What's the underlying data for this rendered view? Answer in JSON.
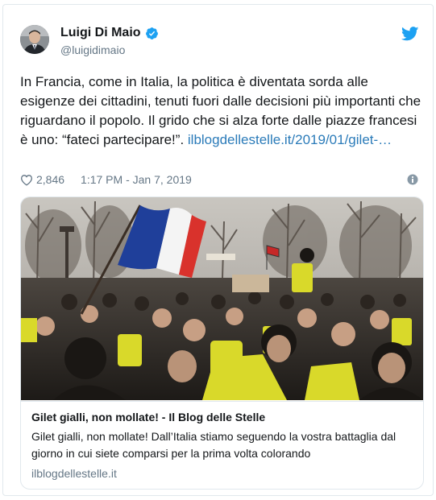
{
  "user": {
    "display_name": "Luigi Di Maio",
    "handle": "@luigidimaio",
    "verified_icon": "verified-badge-icon"
  },
  "tweet": {
    "text": "In Francia, come in Italia, la politica è diventata sorda alle esigenze dei cittadini, tenuti fuori dalle decisioni più importanti che riguardano il popolo. Il grido che si alza forte dalle piazze francesi è uno: “fateci partecipare!”. ",
    "link_text": "ilblogdellestelle.it/2019/01/gilet-…"
  },
  "meta": {
    "likes": "2,846",
    "timestamp": "1:17 PM - Jan 7, 2019"
  },
  "card": {
    "title": "Gilet gialli, non mollate! - Il Blog delle Stelle",
    "description": "Gilet gialli, non mollate! Dall’Italia stiamo seguendo la vostra battaglia dal giorno in cui siete comparsi per la prima volta colorando",
    "domain": "ilblogdellestelle.it"
  },
  "colors": {
    "link": "#2b7bb9",
    "twitter_blue": "#1da1f2",
    "muted": "#657786",
    "border": "#e1e8ed"
  }
}
